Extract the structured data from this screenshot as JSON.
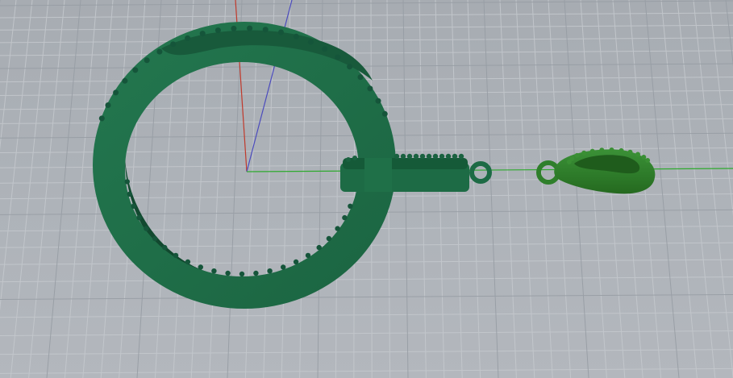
{
  "viewport": {
    "view": "Perspective",
    "background_color": "#acb1b7",
    "grid_color": "#c6cace",
    "major_grid_color": "#9aa0a6",
    "axis_colors": {
      "x": "#2faa2f",
      "y": "#c0392b",
      "z": "#4b4bbd"
    }
  },
  "objects": [
    {
      "name": "ring",
      "color": "#1f6e48"
    },
    {
      "name": "bail-bar",
      "color": "#1d6b45"
    },
    {
      "name": "pendant-bail",
      "color": "#2f7f2b"
    }
  ]
}
